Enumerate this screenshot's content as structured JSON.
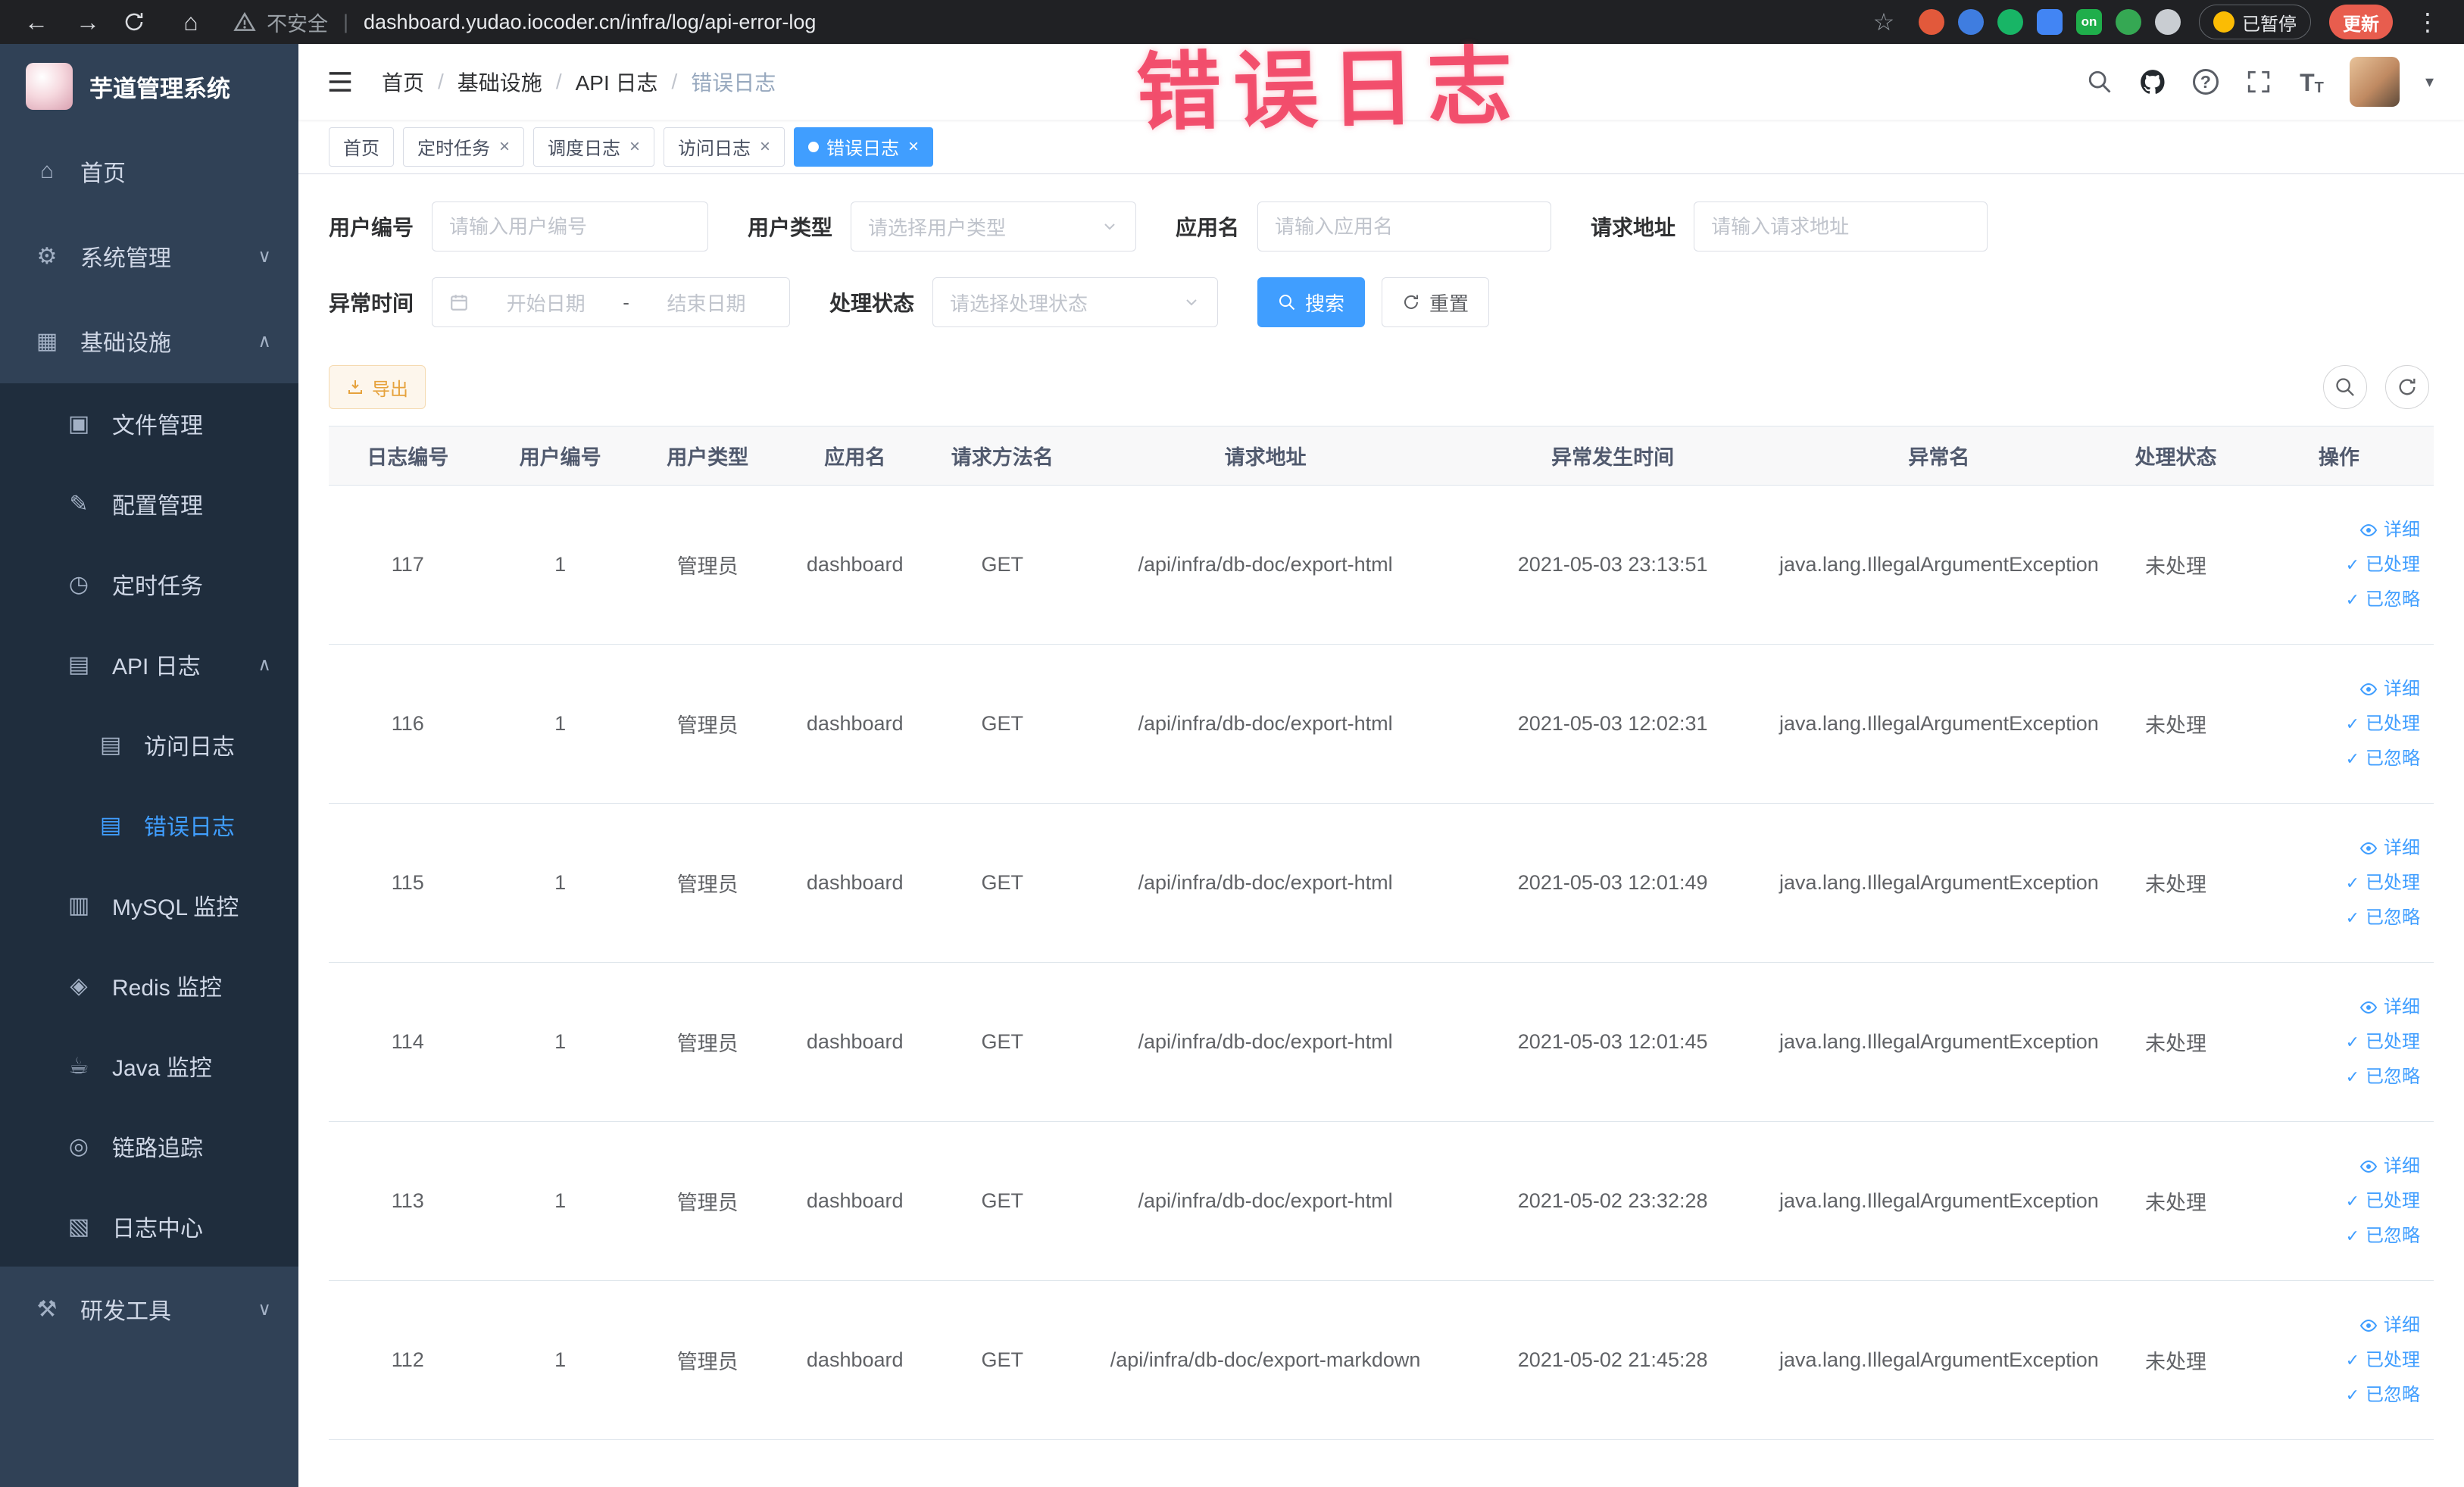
{
  "annotation": {
    "text": "错误日志"
  },
  "browser": {
    "security_label": "不安全",
    "url": "dashboard.yudao.iocoder.cn/infra/log/api-error-log",
    "paused_label": "已暂停",
    "update_label": "更新",
    "extensions": [
      {
        "name": "extension-icon-1",
        "color": "#e2593b",
        "shape": "circle",
        "label": ""
      },
      {
        "name": "extension-icon-2",
        "color": "#3f7de0",
        "shape": "circle",
        "label": ""
      },
      {
        "name": "extension-icon-3",
        "color": "#18b566",
        "shape": "circle",
        "label": ""
      },
      {
        "name": "extension-icon-4",
        "color": "#4285f4",
        "shape": "square",
        "label": ""
      },
      {
        "name": "extension-icon-on",
        "color": "#1fae4b",
        "shape": "square",
        "label": "on"
      },
      {
        "name": "extension-icon-6",
        "color": "#35a853",
        "shape": "circle",
        "label": ""
      },
      {
        "name": "extension-icon-7",
        "color": "#c9cdd2",
        "shape": "circle",
        "label": ""
      }
    ]
  },
  "sidebar": {
    "title": "芋道管理系统",
    "items": [
      {
        "label": "首页",
        "icon": "home-icon",
        "depth": 0
      },
      {
        "label": "系统管理",
        "icon": "gear-icon",
        "depth": 0,
        "expandable": true,
        "expanded": false
      },
      {
        "label": "基础设施",
        "icon": "infra-icon",
        "depth": 0,
        "expandable": true,
        "expanded": true
      },
      {
        "label": "文件管理",
        "icon": "file-icon",
        "depth": 1
      },
      {
        "label": "配置管理",
        "icon": "config-icon",
        "depth": 1
      },
      {
        "label": "定时任务",
        "icon": "timer-icon",
        "depth": 1
      },
      {
        "label": "API 日志",
        "icon": "api-log-icon",
        "depth": 1,
        "expandable": true,
        "expanded": true
      },
      {
        "label": "访问日志",
        "icon": "access-log-icon",
        "depth": 2
      },
      {
        "label": "错误日志",
        "icon": "error-log-icon",
        "depth": 2,
        "active": true
      },
      {
        "label": "MySQL 监控",
        "icon": "mysql-icon",
        "depth": 1
      },
      {
        "label": "Redis 监控",
        "icon": "redis-icon",
        "depth": 1
      },
      {
        "label": "Java 监控",
        "icon": "java-icon",
        "depth": 1
      },
      {
        "label": "链路追踪",
        "icon": "trace-icon",
        "depth": 1
      },
      {
        "label": "日志中心",
        "icon": "log-center-icon",
        "depth": 1
      },
      {
        "label": "研发工具",
        "icon": "devtools-icon",
        "depth": 0,
        "expandable": true,
        "expanded": false
      }
    ]
  },
  "header": {
    "breadcrumb": [
      "首页",
      "基础设施",
      "API 日志",
      "错误日志"
    ]
  },
  "tabs": [
    {
      "label": "首页",
      "closable": false,
      "active": false
    },
    {
      "label": "定时任务",
      "closable": true,
      "active": false
    },
    {
      "label": "调度日志",
      "closable": true,
      "active": false
    },
    {
      "label": "访问日志",
      "closable": true,
      "active": false
    },
    {
      "label": "错误日志",
      "closable": true,
      "active": true
    }
  ],
  "filters": {
    "user_id": {
      "label": "用户编号",
      "placeholder": "请输入用户编号"
    },
    "user_type": {
      "label": "用户类型",
      "placeholder": "请选择用户类型"
    },
    "app_name": {
      "label": "应用名",
      "placeholder": "请输入应用名"
    },
    "req_url": {
      "label": "请求地址",
      "placeholder": "请输入请求地址"
    },
    "time": {
      "label": "异常时间",
      "start_placeholder": "开始日期",
      "end_placeholder": "结束日期",
      "separator": "-"
    },
    "status": {
      "label": "处理状态",
      "placeholder": "请选择处理状态"
    },
    "search_label": "搜索",
    "reset_label": "重置"
  },
  "toolbar": {
    "export_label": "导出"
  },
  "table": {
    "columns": [
      "日志编号",
      "用户编号",
      "用户类型",
      "应用名",
      "请求方法名",
      "请求地址",
      "异常发生时间",
      "异常名",
      "处理状态",
      "操作"
    ],
    "row_actions": [
      {
        "label": "详细",
        "icon": "eye-icon"
      },
      {
        "label": "已处理",
        "icon": "check-icon"
      },
      {
        "label": "已忽略",
        "icon": "check-icon"
      }
    ],
    "rows": [
      [
        "117",
        "1",
        "管理员",
        "dashboard",
        "GET",
        "/api/infra/db-doc/export-html",
        "2021-05-03 23:13:51",
        "java.lang.IllegalArgumentException",
        "未处理"
      ],
      [
        "116",
        "1",
        "管理员",
        "dashboard",
        "GET",
        "/api/infra/db-doc/export-html",
        "2021-05-03 12:02:31",
        "java.lang.IllegalArgumentException",
        "未处理"
      ],
      [
        "115",
        "1",
        "管理员",
        "dashboard",
        "GET",
        "/api/infra/db-doc/export-html",
        "2021-05-03 12:01:49",
        "java.lang.IllegalArgumentException",
        "未处理"
      ],
      [
        "114",
        "1",
        "管理员",
        "dashboard",
        "GET",
        "/api/infra/db-doc/export-html",
        "2021-05-03 12:01:45",
        "java.lang.IllegalArgumentException",
        "未处理"
      ],
      [
        "113",
        "1",
        "管理员",
        "dashboard",
        "GET",
        "/api/infra/db-doc/export-html",
        "2021-05-02 23:32:28",
        "java.lang.IllegalArgumentException",
        "未处理"
      ],
      [
        "112",
        "1",
        "管理员",
        "dashboard",
        "GET",
        "/api/infra/db-doc/export-markdown",
        "2021-05-02 21:45:28",
        "java.lang.IllegalArgumentException",
        "未处理"
      ]
    ]
  }
}
